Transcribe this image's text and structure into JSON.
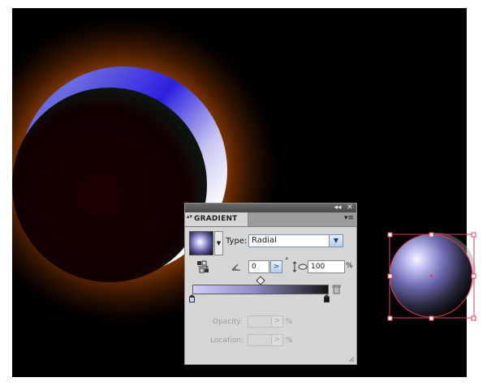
{
  "panel": {
    "collapse_glyph": "◂◂",
    "close_glyph": "✕",
    "tab_label": "GRADIENT",
    "tab_arrows": "▴▾",
    "menu_glyph": "▾≡",
    "type_label": "Type:",
    "type_value": "Radial",
    "angle_value": "0",
    "degree_symbol": "°",
    "aspect_value": "100",
    "aspect_unit": "%",
    "opacity_label": "Opacity:",
    "opacity_unit": "%",
    "location_label": "Location:",
    "location_unit": "%",
    "dropdown_glyph": "▼",
    "stepper_glyph": ">"
  },
  "gradient": {
    "type": "radial",
    "stops": [
      "#cfcff7",
      "#151515"
    ],
    "midpoint_percent": 50
  },
  "colors": {
    "canvas_background": "#000000",
    "glow": "#b8540b",
    "crescent_blue": "#3b32d8",
    "selection": "#e0405a"
  },
  "icons": {
    "reverse": "reverse-gradient-icon",
    "angle": "angle-icon",
    "aspect": "aspect-ratio-icon",
    "delete": "trash-icon",
    "resize": "resize-grip-icon"
  }
}
